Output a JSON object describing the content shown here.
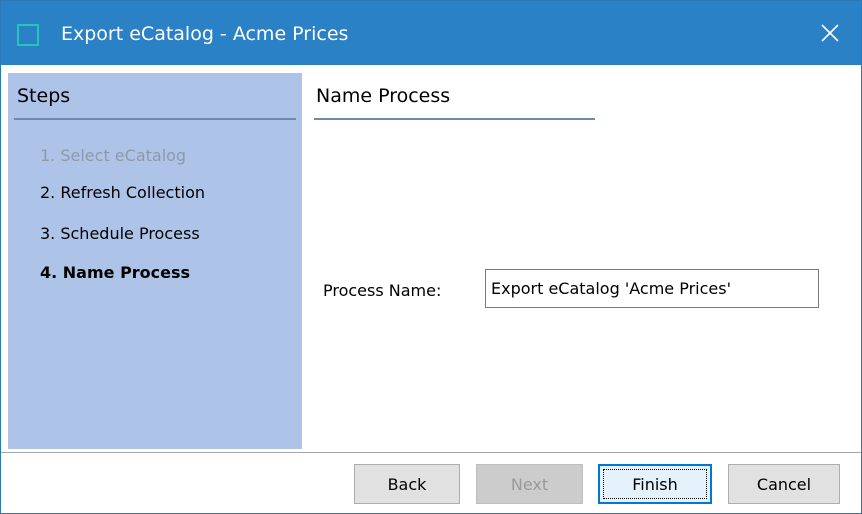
{
  "window": {
    "title": "Export eCatalog - Acme Prices",
    "accent_color": "#2b81c6",
    "icon": "app-icon",
    "close_icon": "close-icon"
  },
  "steps": {
    "heading": "Steps",
    "items": [
      {
        "label": "1. Select eCatalog",
        "state": "disabled"
      },
      {
        "label": "2. Refresh Collection",
        "state": "normal"
      },
      {
        "label": "3. Schedule Process",
        "state": "normal"
      },
      {
        "label": "4. Name Process",
        "state": "active"
      }
    ],
    "panel_color": "#adc4e8"
  },
  "content": {
    "heading": "Name Process",
    "process_name_label": "Process Name:",
    "process_name_value": "Export eCatalog 'Acme Prices'"
  },
  "buttons": {
    "back": "Back",
    "next": "Next",
    "finish": "Finish",
    "cancel": "Cancel"
  }
}
